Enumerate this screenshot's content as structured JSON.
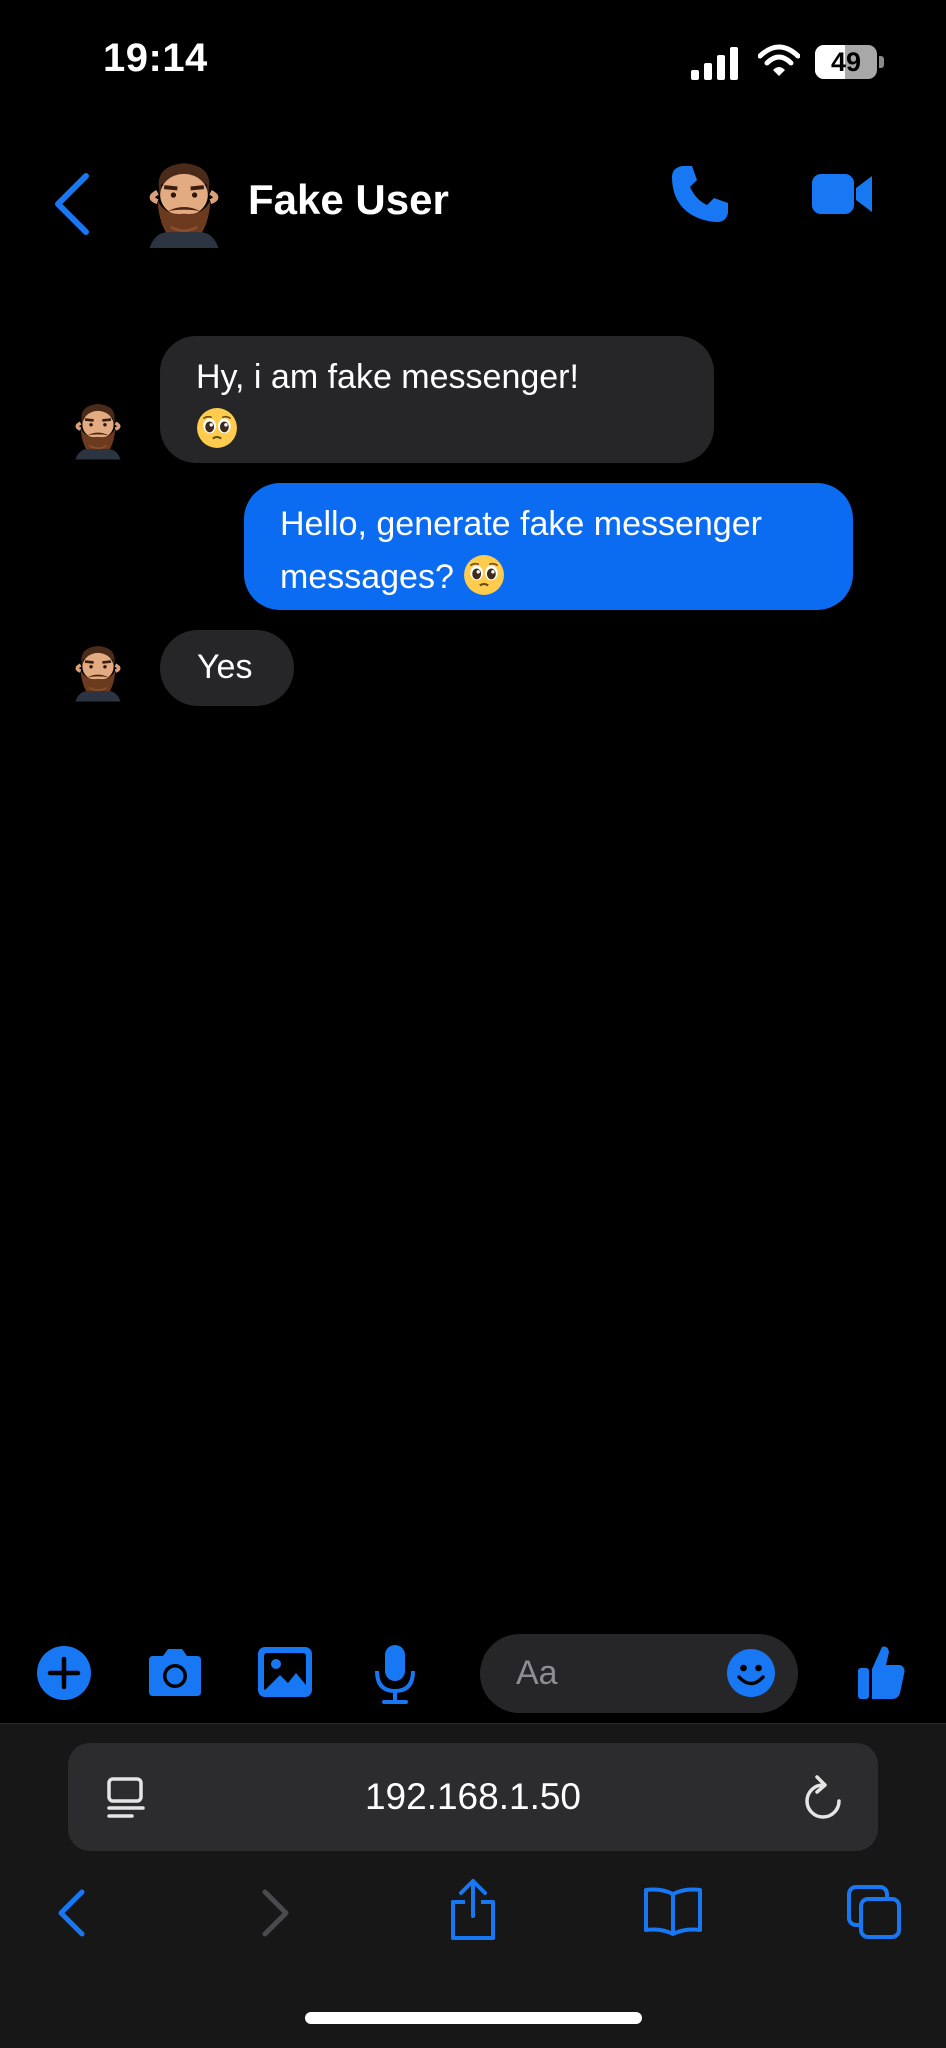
{
  "status_bar": {
    "time": "19:14",
    "battery_level": "49",
    "icons": [
      "signal-icon",
      "wifi-icon",
      "battery-icon"
    ]
  },
  "header": {
    "contact_name": "Fake User",
    "icons": [
      "back-chevron-icon",
      "avatar",
      "phone-icon",
      "video-camera-icon"
    ]
  },
  "messages": [
    {
      "direction": "incoming",
      "text": "Hy, i am fake messenger!",
      "emoji": "pleading-face-emoji"
    },
    {
      "direction": "outgoing",
      "text_line1": "Hello, generate fake messenger",
      "text_line2": "messages?",
      "emoji": "pleading-face-emoji"
    },
    {
      "direction": "incoming",
      "text": "Yes"
    }
  ],
  "composer": {
    "placeholder": "Aa",
    "icons": [
      "plus-icon",
      "camera-icon",
      "image-icon",
      "microphone-icon",
      "smiley-icon",
      "thumbs-up-icon"
    ]
  },
  "browser": {
    "url": "192.168.1.50",
    "icons": [
      "reader-icon",
      "reload-icon",
      "back-icon",
      "forward-icon",
      "share-icon",
      "bookmarks-icon",
      "tabs-icon"
    ]
  },
  "colors": {
    "accent": "#0b6cf2",
    "incoming_bubble": "#262628",
    "background": "#000000"
  }
}
